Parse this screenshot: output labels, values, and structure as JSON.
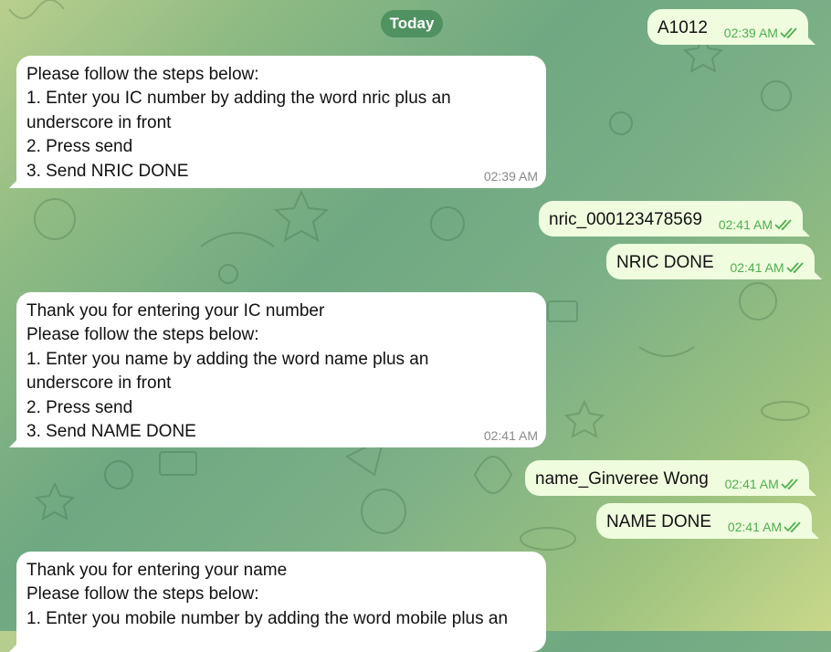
{
  "chat": {
    "date_label": "Today",
    "messages": [
      {
        "direction": "out",
        "lines": [
          "A1012"
        ],
        "time": "02:39 AM",
        "status": "read"
      },
      {
        "direction": "in",
        "lines": [
          "Please follow the steps below:",
          "1. Enter you IC number by adding the word nric plus an",
          "underscore in front",
          "2. Press send",
          "3. Send NRIC DONE"
        ],
        "time": "02:39 AM"
      },
      {
        "direction": "out",
        "lines": [
          "nric_000123478569"
        ],
        "time": "02:41 AM",
        "status": "read"
      },
      {
        "direction": "out",
        "lines": [
          "NRIC DONE"
        ],
        "time": "02:41 AM",
        "status": "read"
      },
      {
        "direction": "in",
        "lines": [
          "Thank you for entering your IC number",
          "Please follow the steps below:",
          "1. Enter you name by adding the word name plus an",
          "underscore in front",
          "2. Press send",
          "3. Send NAME DONE"
        ],
        "time": "02:41 AM"
      },
      {
        "direction": "out",
        "lines": [
          "name_Ginveree Wong"
        ],
        "time": "02:41 AM",
        "status": "read"
      },
      {
        "direction": "out",
        "lines": [
          "NAME DONE"
        ],
        "time": "02:41 AM",
        "status": "read"
      },
      {
        "direction": "in",
        "lines": [
          "Thank you for entering your name",
          "Please follow the steps below:",
          "1. Enter you mobile number by adding the word mobile plus an"
        ],
        "time": ""
      }
    ]
  },
  "colors": {
    "incoming_bubble": "#ffffff",
    "outgoing_bubble": "#effdde",
    "outgoing_meta": "#4fae4e",
    "incoming_meta": "#8a8a8a",
    "date_pill": "#4a8e5c"
  },
  "icons": {
    "read_status": "double-check-icon",
    "wallpaper": "doodle-pattern"
  }
}
